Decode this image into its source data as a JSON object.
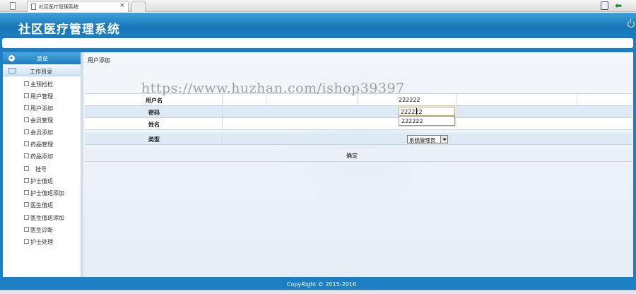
{
  "browser": {
    "tab_title": "社区医疗管理系统",
    "tab_close": "×"
  },
  "header": {
    "title": "社区医疗管理系统"
  },
  "sidebar": {
    "menu_label": "菜单",
    "group_label": "工作目录",
    "items": [
      {
        "label": "主预检检"
      },
      {
        "label": "用户管理"
      },
      {
        "label": "用户添加"
      },
      {
        "label": "会员管理"
      },
      {
        "label": "会员添加"
      },
      {
        "label": "药品管理"
      },
      {
        "label": "药品添加"
      },
      {
        "label": "挂号"
      },
      {
        "label": "护士值班"
      },
      {
        "label": "护士值班添加"
      },
      {
        "label": "医生值班"
      },
      {
        "label": "医生值班添加"
      },
      {
        "label": "医生诊断"
      },
      {
        "label": "护士处理"
      }
    ]
  },
  "content": {
    "breadcrumb": "用户添加",
    "watermark": "https://www.huzhan.com/ishop39397",
    "form": {
      "username_label": "用户名",
      "username_value": "222222",
      "password_label": "密码",
      "password_value": "222222",
      "autocomplete_suggestion": "222222",
      "name_label": "姓名",
      "type_label": "类型",
      "type_selected": "系统管理员",
      "submit_label": "确定"
    }
  },
  "footer": {
    "copyright": "CopyRight © 2015-2016"
  }
}
